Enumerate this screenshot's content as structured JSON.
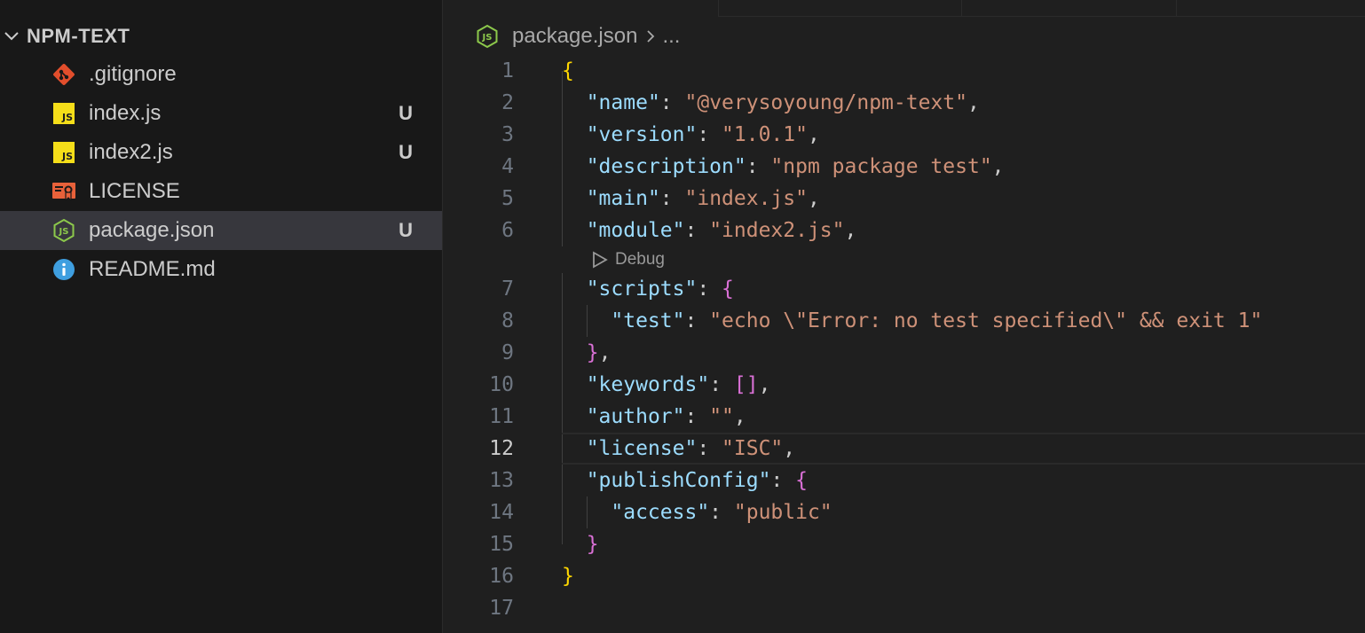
{
  "explorer": {
    "folder_name": "NPM-TEXT",
    "files": [
      {
        "name": ".gitignore",
        "icon": "git-icon",
        "status": ""
      },
      {
        "name": "index.js",
        "icon": "js-file-icon",
        "status": "U"
      },
      {
        "name": "index2.js",
        "icon": "js-file-icon",
        "status": "U"
      },
      {
        "name": "LICENSE",
        "icon": "license-icon",
        "status": ""
      },
      {
        "name": "package.json",
        "icon": "nodejs-icon",
        "status": "U",
        "selected": true
      },
      {
        "name": "README.md",
        "icon": "info-icon",
        "status": ""
      }
    ],
    "js_badge": "JS"
  },
  "breadcrumb": {
    "file": "package.json",
    "ellipsis": "..."
  },
  "codelens": {
    "label": "Debug"
  },
  "code": {
    "line_numbers": [
      "1",
      "2",
      "3",
      "4",
      "5",
      "6",
      "7",
      "8",
      "9",
      "10",
      "11",
      "12",
      "13",
      "14",
      "15",
      "16",
      "17"
    ],
    "current_line": 12,
    "tokens": {
      "name_key": "\"name\"",
      "name_val": "\"@verysoyoung/npm-text\"",
      "version_key": "\"version\"",
      "version_val": "\"1.0.1\"",
      "description_key": "\"description\"",
      "description_val": "\"npm package test\"",
      "main_key": "\"main\"",
      "main_val": "\"index.js\"",
      "module_key": "\"module\"",
      "module_val": "\"index2.js\"",
      "scripts_key": "\"scripts\"",
      "test_key": "\"test\"",
      "test_val": "\"echo \\\"Error: no test specified\\\" && exit 1\"",
      "keywords_key": "\"keywords\"",
      "author_key": "\"author\"",
      "author_val": "\"\"",
      "license_key": "\"license\"",
      "license_val": "\"ISC\"",
      "publish_key": "\"publishConfig\"",
      "access_key": "\"access\"",
      "access_val": "\"public\""
    }
  },
  "colors": {
    "key": "#9cdcfe",
    "string": "#ce9178",
    "bracket_level1": "#ffd700",
    "bracket_level2": "#da70d6",
    "selected_row": "#37373d"
  }
}
